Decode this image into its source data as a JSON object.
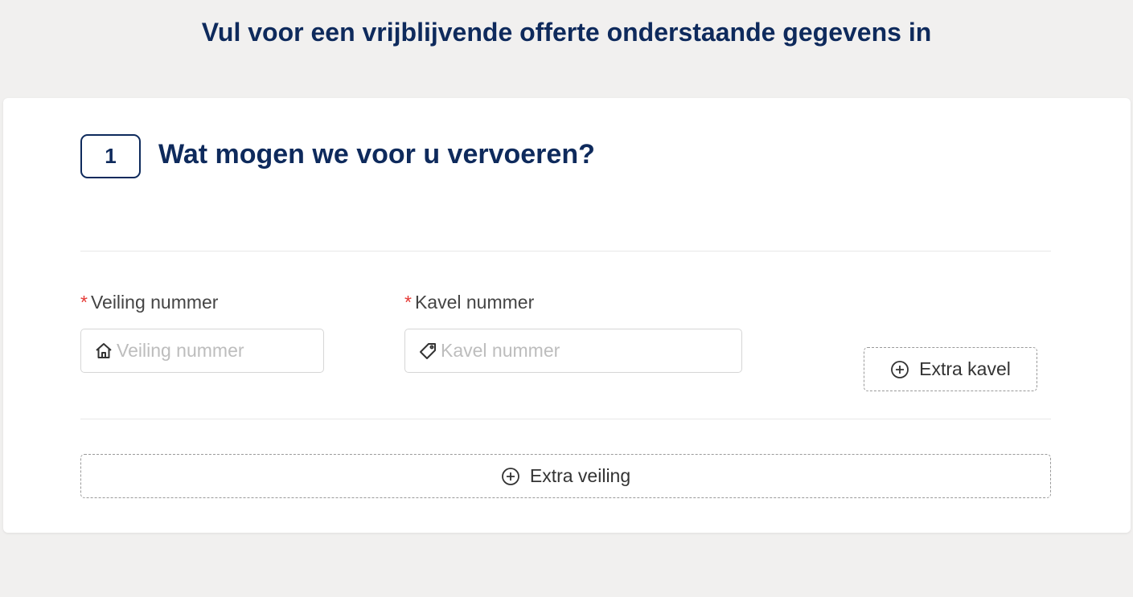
{
  "page": {
    "title": "Vul voor een vrijblijvende offerte onderstaande gegevens in"
  },
  "section": {
    "step_number": "1",
    "heading": "Wat mogen we voor u vervoeren?"
  },
  "fields": {
    "auction": {
      "required_marker": "*",
      "label": "Veiling nummer",
      "placeholder": "Veiling nummer",
      "value": "",
      "icon": "home-icon"
    },
    "lot": {
      "required_marker": "*",
      "label": "Kavel nummer",
      "placeholder": "Kavel nummer",
      "value": "",
      "icon": "tag-icon"
    }
  },
  "buttons": {
    "extra_lot": {
      "label": "Extra kavel",
      "icon": "plus-circle-icon"
    },
    "extra_auction": {
      "label": "Extra veiling",
      "icon": "plus-circle-icon"
    }
  },
  "colors": {
    "brand_navy": "#0e2a5c",
    "required_red": "#e53935",
    "background": "#f1f0ef"
  }
}
